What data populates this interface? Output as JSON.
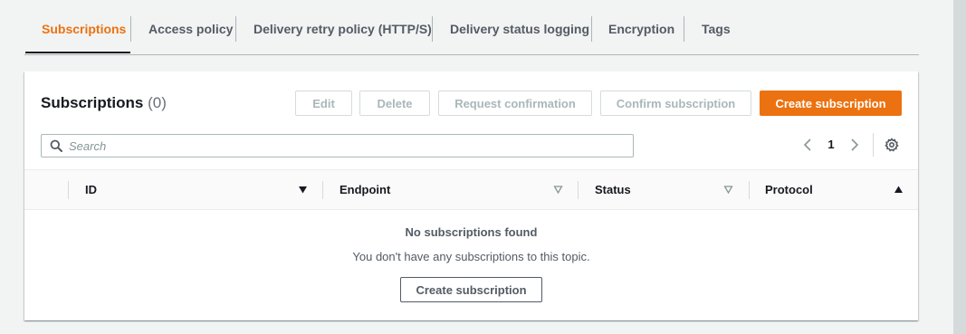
{
  "tabs": [
    {
      "label": "Subscriptions",
      "active": true
    },
    {
      "label": "Access policy",
      "active": false
    },
    {
      "label": "Delivery retry policy (HTTP/S)",
      "active": false
    },
    {
      "label": "Delivery status logging",
      "active": false
    },
    {
      "label": "Encryption",
      "active": false
    },
    {
      "label": "Tags",
      "active": false
    }
  ],
  "panel": {
    "title": "Subscriptions",
    "count": "(0)",
    "buttons": {
      "edit": "Edit",
      "delete": "Delete",
      "request_confirmation": "Request confirmation",
      "confirm_subscription": "Confirm subscription",
      "create_subscription": "Create subscription"
    },
    "search": {
      "placeholder": "Search",
      "value": "",
      "icon": "search-icon"
    },
    "pagination": {
      "current_page": "1",
      "prev_icon": "chevron-left-icon",
      "next_icon": "chevron-right-icon",
      "settings_icon": "gear-icon"
    },
    "table": {
      "columns": [
        {
          "label": "ID",
          "sort": "descending-active"
        },
        {
          "label": "Endpoint",
          "sort": "descending"
        },
        {
          "label": "Status",
          "sort": "descending"
        },
        {
          "label": "Protocol",
          "sort": "ascending-active"
        }
      ],
      "rows": []
    },
    "empty_state": {
      "title": "No subscriptions found",
      "description": "You don't have any subscriptions to this topic.",
      "button": "Create subscription"
    }
  },
  "colors": {
    "accent": "#ec7211",
    "text": "#16191f",
    "muted": "#545b64",
    "disabled": "#aab7b8",
    "background": "#f2f3f3",
    "panel": "#ffffff"
  }
}
